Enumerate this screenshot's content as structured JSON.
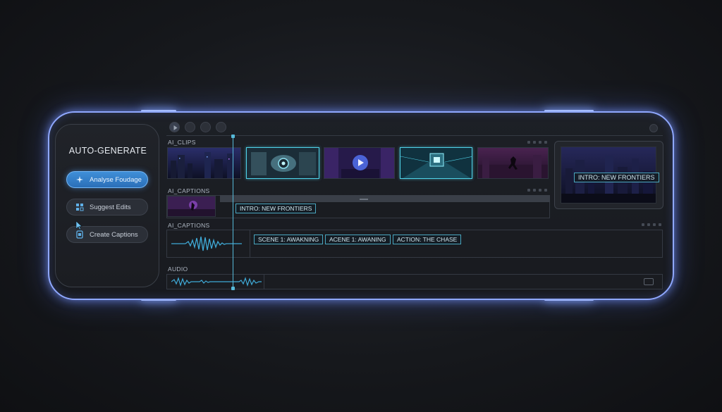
{
  "sidebar": {
    "title": "AUTO-GENERATE",
    "buttons": [
      {
        "label": "Analyse Foudage",
        "icon": "sparkle-icon",
        "active": true
      },
      {
        "label": "Suggest Edits",
        "icon": "grid-edit-icon",
        "active": false
      },
      {
        "label": "Create Captions",
        "icon": "caption-doc-icon",
        "active": false
      }
    ]
  },
  "toolbar": [
    "play-icon",
    "record-icon",
    "grid-icon",
    "link-icon"
  ],
  "tracks": {
    "clips_label": "AI_CLIPS",
    "captions_label_1": "AI_CAPTIONS",
    "captions_label_2": "AI_CAPTIONS",
    "audio_label": "AUDIO"
  },
  "captions": {
    "intro": "INTRO: NEW FRONTIERS",
    "scene1": "SCENE 1: AWAKNING",
    "scene2": "ACENE 1: AWANING",
    "action": "ACTION: THE CHASE"
  },
  "preview": {
    "title": "INTRO: NEW FRONTIERS"
  },
  "colors": {
    "accent": "#56b9d8",
    "frame_glow": "#8fa8ff",
    "active_button": "#3f8fd8"
  }
}
